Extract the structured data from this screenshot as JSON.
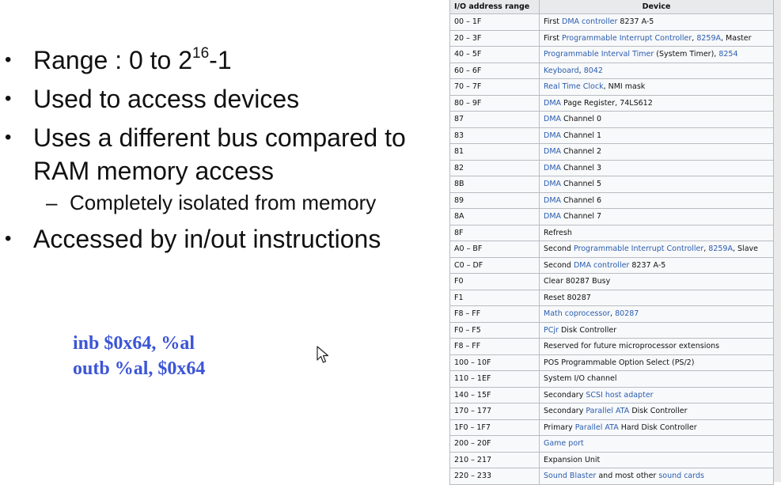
{
  "slide": {
    "bullets": [
      {
        "parts": [
          {
            "t": "Range : 0 to 2"
          },
          {
            "t": "16",
            "sup": true
          },
          {
            "t": "-1"
          }
        ]
      },
      {
        "parts": [
          {
            "t": "Used to access devices"
          }
        ]
      },
      {
        "parts": [
          {
            "t": "Uses a different bus compared to RAM memory access"
          }
        ]
      },
      {
        "parts": [
          {
            "t": "Completely isolated from memory"
          }
        ],
        "sub": true
      },
      {
        "parts": [
          {
            "t": "Accessed by in/out instructions"
          }
        ]
      }
    ],
    "code_lines": [
      "inb $0x64, %al",
      "outb %al, $0x64"
    ]
  },
  "table": {
    "headers": [
      "I/O address range",
      "Device"
    ],
    "rows": [
      {
        "range": "00 – 1F",
        "device": [
          {
            "t": "First "
          },
          {
            "t": "DMA controller",
            "link": true
          },
          {
            "t": " 8237 A-5"
          }
        ]
      },
      {
        "range": "20 – 3F",
        "device": [
          {
            "t": "First "
          },
          {
            "t": "Programmable Interrupt Controller",
            "link": true
          },
          {
            "t": ", "
          },
          {
            "t": "8259A",
            "link": true
          },
          {
            "t": ", Master"
          }
        ]
      },
      {
        "range": "40 – 5F",
        "device": [
          {
            "t": "Programmable Interval Timer",
            "link": true
          },
          {
            "t": " (System Timer), "
          },
          {
            "t": "8254",
            "link": true
          }
        ]
      },
      {
        "range": "60 – 6F",
        "device": [
          {
            "t": "Keyboard",
            "link": true
          },
          {
            "t": ", "
          },
          {
            "t": "8042",
            "link": true
          }
        ]
      },
      {
        "range": "70 – 7F",
        "device": [
          {
            "t": "Real Time Clock",
            "link": true
          },
          {
            "t": ", NMI mask"
          }
        ]
      },
      {
        "range": "80 – 9F",
        "device": [
          {
            "t": "DMA",
            "link": true
          },
          {
            "t": " Page Register, 74LS612"
          }
        ]
      },
      {
        "range": "87",
        "device": [
          {
            "t": "DMA",
            "link": true
          },
          {
            "t": " Channel 0"
          }
        ]
      },
      {
        "range": "83",
        "device": [
          {
            "t": "DMA",
            "link": true
          },
          {
            "t": " Channel 1"
          }
        ]
      },
      {
        "range": "81",
        "device": [
          {
            "t": "DMA",
            "link": true
          },
          {
            "t": " Channel 2"
          }
        ]
      },
      {
        "range": "82",
        "device": [
          {
            "t": "DMA",
            "link": true
          },
          {
            "t": " Channel 3"
          }
        ]
      },
      {
        "range": "8B",
        "device": [
          {
            "t": "DMA",
            "link": true
          },
          {
            "t": " Channel 5"
          }
        ]
      },
      {
        "range": "89",
        "device": [
          {
            "t": "DMA",
            "link": true
          },
          {
            "t": " Channel 6"
          }
        ]
      },
      {
        "range": "8A",
        "device": [
          {
            "t": "DMA",
            "link": true
          },
          {
            "t": " Channel 7"
          }
        ]
      },
      {
        "range": "8F",
        "device": [
          {
            "t": "Refresh"
          }
        ]
      },
      {
        "range": "A0 – BF",
        "device": [
          {
            "t": "Second "
          },
          {
            "t": "Programmable Interrupt Controller",
            "link": true
          },
          {
            "t": ", "
          },
          {
            "t": "8259A",
            "link": true
          },
          {
            "t": ", Slave"
          }
        ]
      },
      {
        "range": "C0 – DF",
        "device": [
          {
            "t": "Second "
          },
          {
            "t": "DMA controller",
            "link": true
          },
          {
            "t": " 8237 A-5"
          }
        ]
      },
      {
        "range": "F0",
        "device": [
          {
            "t": "Clear 80287 Busy"
          }
        ]
      },
      {
        "range": "F1",
        "device": [
          {
            "t": "Reset 80287"
          }
        ]
      },
      {
        "range": "F8 – FF",
        "device": [
          {
            "t": "Math coprocessor",
            "link": true
          },
          {
            "t": ", "
          },
          {
            "t": "80287",
            "link": true
          }
        ]
      },
      {
        "range": "F0 – F5",
        "device": [
          {
            "t": "PCjr",
            "link": true
          },
          {
            "t": " Disk Controller"
          }
        ]
      },
      {
        "range": "F8 – FF",
        "device": [
          {
            "t": "Reserved for future microprocessor extensions"
          }
        ]
      },
      {
        "range": "100 – 10F",
        "device": [
          {
            "t": "POS Programmable Option Select (PS/2)"
          }
        ]
      },
      {
        "range": "110 – 1EF",
        "device": [
          {
            "t": "System I/O channel"
          }
        ]
      },
      {
        "range": "140 – 15F",
        "device": [
          {
            "t": "Secondary "
          },
          {
            "t": "SCSI host adapter",
            "link": true
          }
        ]
      },
      {
        "range": "170 – 177",
        "device": [
          {
            "t": "Secondary "
          },
          {
            "t": "Parallel ATA",
            "link": true
          },
          {
            "t": " Disk Controller"
          }
        ]
      },
      {
        "range": "1F0 – 1F7",
        "device": [
          {
            "t": "Primary "
          },
          {
            "t": "Parallel ATA",
            "link": true
          },
          {
            "t": " Hard Disk Controller"
          }
        ]
      },
      {
        "range": "200 – 20F",
        "device": [
          {
            "t": "Game port",
            "link": true
          }
        ]
      },
      {
        "range": "210 – 217",
        "device": [
          {
            "t": "Expansion Unit"
          }
        ]
      },
      {
        "range": "220 – 233",
        "device": [
          {
            "t": "Sound Blaster",
            "link": true
          },
          {
            "t": " and most other "
          },
          {
            "t": "sound cards",
            "link": true
          }
        ]
      }
    ]
  },
  "cursor": {
    "icon": "mouse-pointer-icon"
  },
  "colors": {
    "code": "#3c55d6",
    "link": "#2a5db0",
    "table_border": "#b8bcc2"
  }
}
